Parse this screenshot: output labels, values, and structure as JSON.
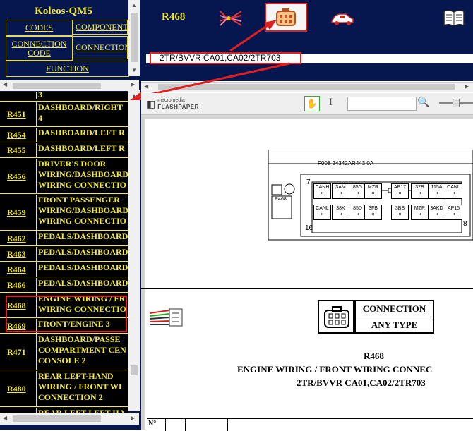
{
  "nav": {
    "title": "Koleos-QM5",
    "tabs": [
      "CODES",
      "COMPONENTS",
      "CONNECTION CODE",
      "CONNECTIONS",
      "FUNCTION"
    ]
  },
  "list": {
    "partial_top": "3",
    "items": [
      {
        "code": "R451",
        "desc": [
          "DASHBOARD/RIGHT",
          "4"
        ]
      },
      {
        "code": "R454",
        "desc": [
          "DASHBOARD/LEFT R"
        ]
      },
      {
        "code": "R455",
        "desc": [
          "DASHBOARD/LEFT R"
        ]
      },
      {
        "code": "R456",
        "desc": [
          "DRIVER'S DOOR",
          "WIRING/DASHBOARD",
          "WIRING CONNECTIO"
        ]
      },
      {
        "code": "R459",
        "desc": [
          "FRONT PASSENGER",
          "WIRING/DASHBOARD",
          "WIRING CONNECTIO"
        ]
      },
      {
        "code": "R462",
        "desc": [
          "PEDALS/DASHBOARD"
        ]
      },
      {
        "code": "R463",
        "desc": [
          "PEDALS/DASHBOARD"
        ]
      },
      {
        "code": "R464",
        "desc": [
          "PEDALS/DASHBOARD"
        ]
      },
      {
        "code": "R466",
        "desc": [
          "PEDALS/DASHBOARD"
        ]
      },
      {
        "code": "R468",
        "desc": [
          "ENGINE WIRING / FR",
          "WIRING CONNECTIO"
        ]
      },
      {
        "code": "R469",
        "desc": [
          "FRONT/ENGINE 3"
        ]
      },
      {
        "code": "R471",
        "desc": [
          "DASHBOARD/PASSE",
          "COMPARTMENT CEN",
          "CONSOLE 2"
        ]
      },
      {
        "code": "R480",
        "desc": [
          "REAR LEFT-HAND",
          "WIRING / FRONT WI",
          "CONNECTION 2"
        ]
      },
      {
        "code": "",
        "desc": [
          "REAR LEFT-LEFT HA"
        ]
      }
    ]
  },
  "header": {
    "code": "R468",
    "path": "2TR/BVVR CA01,CA02/2TR703"
  },
  "flashpaper": {
    "brand_small": "macromedia",
    "brand_big": "FLASHPAPER",
    "search_value": ""
  },
  "diagram": {
    "ref": "F008 24342AR443 0A",
    "conn_label": "R468",
    "pin_first": "7",
    "pin_last": "8",
    "pin_bottom": "16",
    "row1": [
      "CANH",
      "3AM",
      "85G",
      "MZR",
      "AP17",
      "32B",
      "115A",
      "CANL"
    ],
    "row2": [
      "CANL",
      "38K",
      "85D",
      "3FB",
      "3BS",
      "MZR",
      "3AKD",
      "AP15"
    ]
  },
  "connection": {
    "line1": "CONNECTION",
    "line2": "ANY TYPE",
    "code": "R468",
    "title": "ENGINE WIRING / FRONT WIRING CONNEC",
    "path": "2TR/BVVR CA01,CA02/2TR703"
  },
  "table_header": [
    "N°"
  ]
}
